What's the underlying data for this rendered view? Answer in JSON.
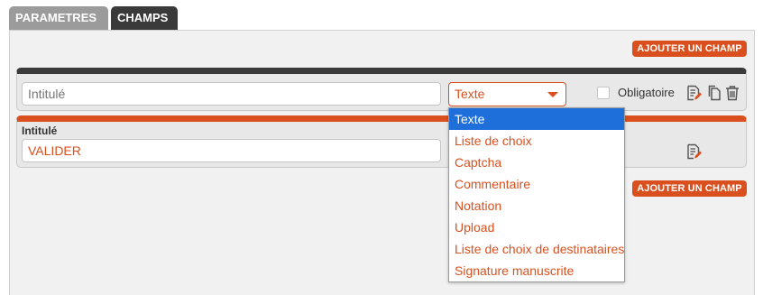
{
  "tabs": [
    {
      "label": "PARAMETRES"
    },
    {
      "label": "CHAMPS"
    }
  ],
  "buttons": {
    "add_field_top": "AJOUTER UN CHAMP",
    "add_field_bottom": "AJOUTER UN CHAMP"
  },
  "field1": {
    "title_placeholder": "Intitulé",
    "type_selected": "Texte",
    "required_label": "Obligatoire",
    "required_checked": false
  },
  "field2": {
    "title_label": "Intitulé",
    "title_value": "VALIDER"
  },
  "type_options": [
    "Texte",
    "Liste de choix",
    "Captcha",
    "Commentaire",
    "Notation",
    "Upload",
    "Liste de choix de destinataires",
    "Signature manuscrite"
  ],
  "colors": {
    "accent": "#d9501e",
    "selected": "#1e6fd9",
    "dark_tab": "#3a3a3a",
    "inactive_tab": "#9b9b9b"
  },
  "icons": [
    "edit-icon",
    "copy-icon",
    "trash-icon"
  ]
}
